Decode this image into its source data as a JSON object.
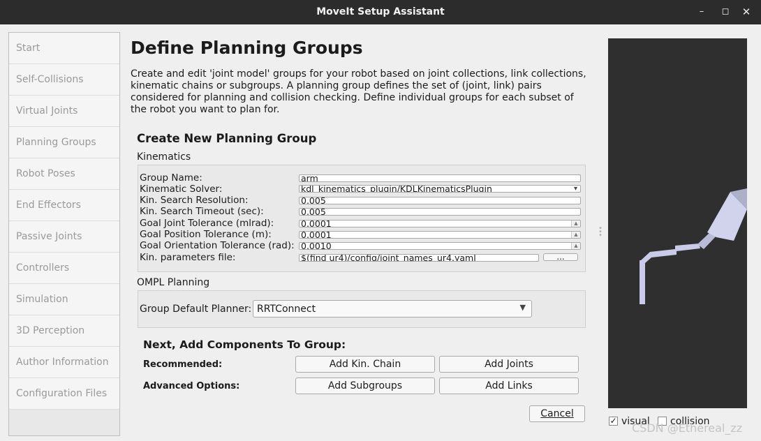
{
  "window": {
    "title": "MoveIt Setup Assistant",
    "controls": [
      "minimize-icon",
      "maximize-icon",
      "close-icon"
    ]
  },
  "sidebar": {
    "items": [
      {
        "label": "Start"
      },
      {
        "label": "Self-Collisions"
      },
      {
        "label": "Virtual Joints"
      },
      {
        "label": "Planning Groups"
      },
      {
        "label": "Robot Poses"
      },
      {
        "label": "End Effectors"
      },
      {
        "label": "Passive Joints"
      },
      {
        "label": "Controllers"
      },
      {
        "label": "Simulation"
      },
      {
        "label": "3D Perception"
      },
      {
        "label": "Author Information"
      },
      {
        "label": "Configuration Files"
      }
    ]
  },
  "main": {
    "title": "Define Planning Groups",
    "description": "Create and edit 'joint model' groups for your robot based on joint collections, link collections, kinematic chains or subgroups. A planning group defines the set of (joint, link) pairs considered for planning and collision checking. Define individual groups for each subset of the robot you want to plan for.",
    "create_heading": "Create New Planning Group",
    "kinematics": {
      "label": "Kinematics",
      "fields": [
        {
          "label": "Group Name:",
          "value": "arm"
        },
        {
          "label": "Kinematic Solver:",
          "value": "kdl_kinematics_plugin/KDLKinematicsPlugin"
        },
        {
          "label": "Kin. Search Resolution:",
          "value": "0.005"
        },
        {
          "label": "Kin. Search Timeout (sec):",
          "value": "0.005"
        },
        {
          "label": "Goal Joint Tolerance (mlrad):",
          "value": "0.0001"
        },
        {
          "label": "Goal Position Tolerance (m):",
          "value": "0.0001"
        },
        {
          "label": "Goal Orientation Tolerance (rad):",
          "value": "0.0010"
        },
        {
          "label": "Kin. parameters file:",
          "value": "$(find ur4)/config/joint_names_ur4.yaml"
        }
      ],
      "browse_label": "..."
    },
    "ompl": {
      "label": "OMPL Planning",
      "planner_label": "Group Default Planner:",
      "planner_value": "RRTConnect"
    },
    "components": {
      "heading": "Next, Add Components To Group:",
      "recommended_label": "Recommended:",
      "advanced_label": "Advanced Options:",
      "add_kin_chain": "Add Kin. Chain",
      "add_joints": "Add Joints",
      "add_subgroups": "Add Subgroups",
      "add_links": "Add Links"
    },
    "cancel_label": "Cancel"
  },
  "viewer": {
    "visual_label": "visual",
    "visual_checked": true,
    "collision_label": "collision",
    "collision_checked": false
  },
  "watermark": "CSDN @Ethereal_zz",
  "colors": {
    "titlebar": "#2c2c2c",
    "viewer_bg": "#2f2f2f",
    "robot": "#c9cbe8"
  }
}
